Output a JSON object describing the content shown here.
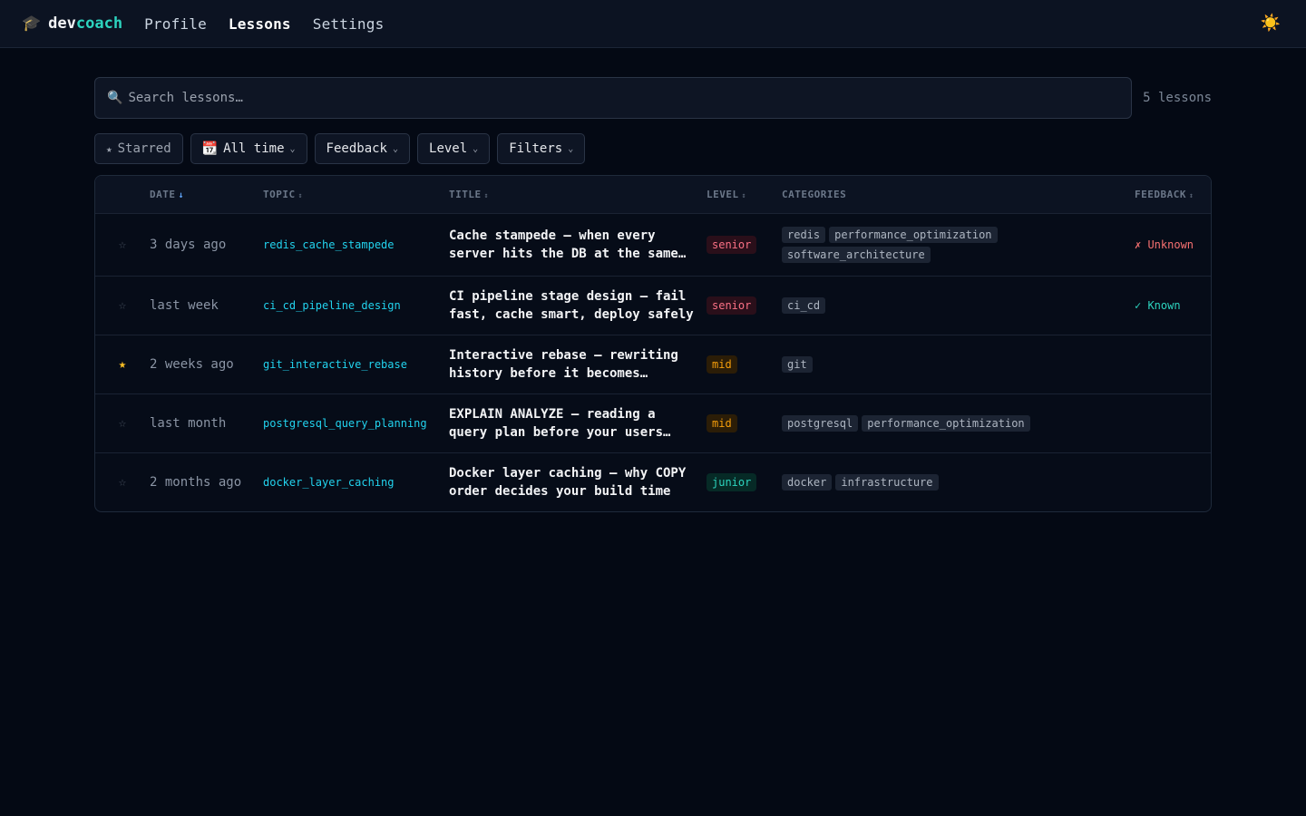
{
  "app": {
    "logo_icon": "🎓",
    "logo_dev": "dev",
    "logo_coach": "coach",
    "nav": [
      {
        "label": "Profile",
        "active": false
      },
      {
        "label": "Lessons",
        "active": true
      },
      {
        "label": "Settings",
        "active": false
      }
    ],
    "theme_icon": "☀️"
  },
  "search": {
    "icon": "🔍",
    "placeholder": "Search lessons…",
    "value": "",
    "count_label": "5 lessons"
  },
  "filters": {
    "starred": {
      "icon": "★",
      "label": "Starred"
    },
    "time": {
      "icon": "📆",
      "label": "All time"
    },
    "feedback": {
      "label": "Feedback"
    },
    "level": {
      "label": "Level"
    },
    "more": {
      "label": "Filters"
    },
    "chevron": "⌄"
  },
  "table": {
    "headers": {
      "date": "DATE",
      "topic": "TOPIC",
      "title": "TITLE",
      "level": "LEVEL",
      "categories": "CATEGORIES",
      "feedback": "FEEDBACK",
      "sort_active": "↓",
      "sort_idle": "↕"
    },
    "rows": [
      {
        "starred": false,
        "date": "3 days ago",
        "topic": "redis_cache_stampede",
        "title": "Cache stampede — when every server hits the DB at the same time",
        "level": "senior",
        "categories": [
          "redis",
          "performance_optimization",
          "software_architecture"
        ],
        "feedback": "✗ Unknown",
        "feedback_type": "unknown"
      },
      {
        "starred": false,
        "date": "last week",
        "topic": "ci_cd_pipeline_design",
        "title": "CI pipeline stage design — fail fast, cache smart, deploy safely",
        "level": "senior",
        "categories": [
          "ci_cd"
        ],
        "feedback": "✓ Known",
        "feedback_type": "known"
      },
      {
        "starred": true,
        "date": "2 weeks ago",
        "topic": "git_interactive_rebase",
        "title": "Interactive rebase — rewriting history before it becomes permanent",
        "level": "mid",
        "categories": [
          "git"
        ],
        "feedback": "",
        "feedback_type": ""
      },
      {
        "starred": false,
        "date": "last month",
        "topic": "postgresql_query_planning",
        "title": "EXPLAIN ANALYZE — reading a query plan before your users notice",
        "level": "mid",
        "categories": [
          "postgresql",
          "performance_optimization"
        ],
        "feedback": "",
        "feedback_type": ""
      },
      {
        "starred": false,
        "date": "2 months ago",
        "topic": "docker_layer_caching",
        "title": "Docker layer caching — why COPY order decides your build time",
        "level": "junior",
        "categories": [
          "docker",
          "infrastructure"
        ],
        "feedback": "",
        "feedback_type": ""
      }
    ]
  },
  "colors": {
    "background": "#040914",
    "accent": "#2dd4bf",
    "topic_link": "#22d3ee",
    "star_active": "#fbbf24"
  }
}
